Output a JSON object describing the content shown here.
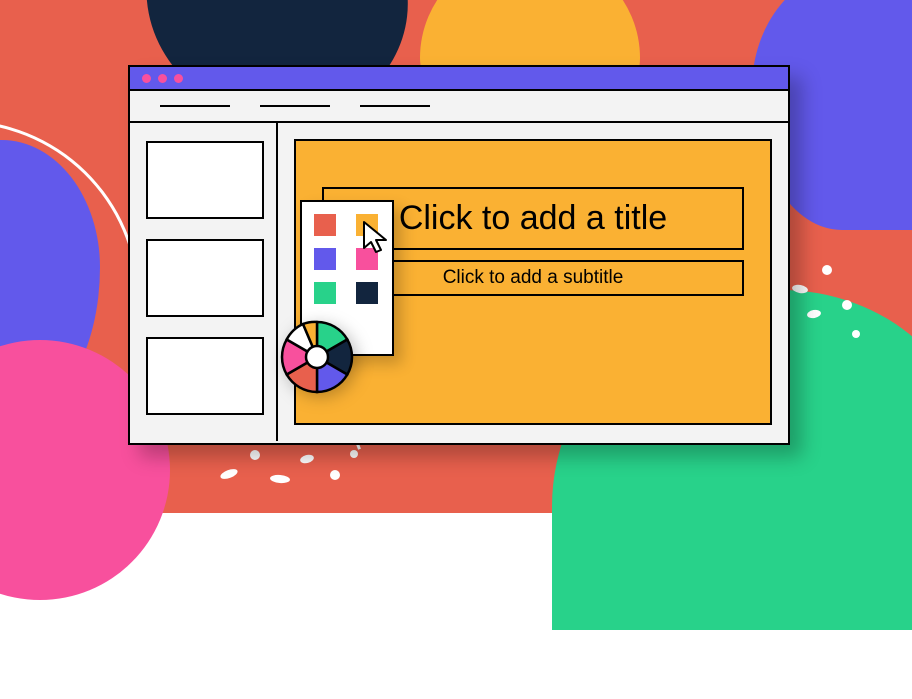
{
  "background": {
    "base": "#e8604d",
    "blobs": [
      "#12253e",
      "#fab133",
      "#6259eb",
      "#f8509d",
      "#28d28a"
    ]
  },
  "window": {
    "titlebarColor": "#6259eb",
    "dotColor": "#f8509d",
    "menuItems": [
      "",
      "",
      ""
    ]
  },
  "sidebar": {
    "thumbnailCount": 3
  },
  "slide": {
    "background": "#fab133",
    "titlePlaceholder": "Click to add a title",
    "subtitlePlaceholder": "Click to add a subtitle"
  },
  "colorPicker": {
    "swatches": [
      "#e8604d",
      "#fab133",
      "#6259eb",
      "#f8509d",
      "#28d28a",
      "#12253e"
    ],
    "wheel": [
      "#12253e",
      "#28d28a",
      "#6259eb",
      "#fab133",
      "#fff",
      "#f8509d",
      "#e8604d"
    ]
  },
  "cursor": {
    "target": "swatch-1"
  }
}
